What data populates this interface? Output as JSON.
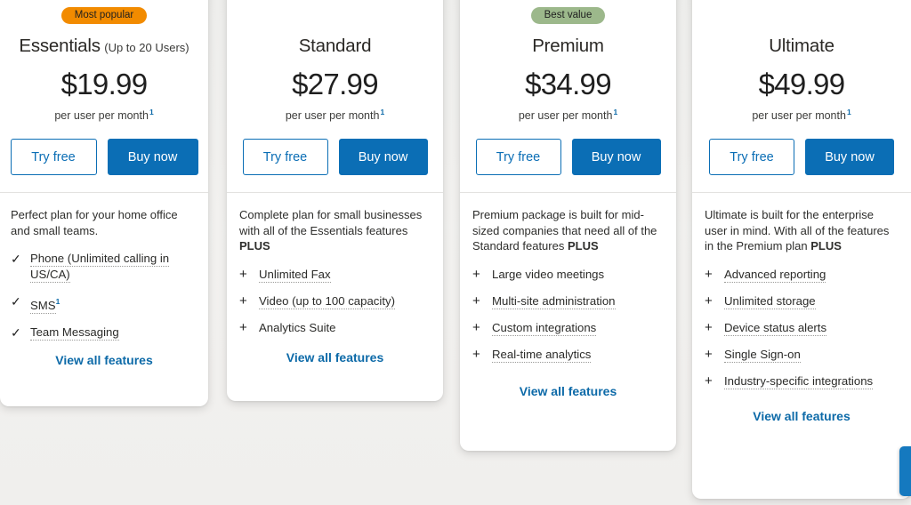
{
  "page": {
    "background_color": "#f1f0ee",
    "accent_blue": "#0b6eb5",
    "link_blue": "#0d6aa8",
    "badge_orange": "#f28b00",
    "badge_green": "#9cb88b"
  },
  "common": {
    "try_free_label": "Try free",
    "buy_now_label": "Buy now",
    "view_all_label": "View all features",
    "per_unit": "per user per month",
    "footnote_marker": "1",
    "check_icon": "✓",
    "plus_icon": "+"
  },
  "plans": [
    {
      "id": "essentials",
      "badge": "Most popular",
      "badge_style": "popular",
      "name": "Essentials",
      "qualifier": "(Up to 20 Users)",
      "price": "$19.99",
      "description_plain": "Perfect plan for your home office and small teams.",
      "description_bold": "",
      "feature_icon": "check",
      "features": [
        {
          "text": "Phone (Unlimited calling in US/CA)",
          "underlined": true,
          "footnote": false
        },
        {
          "text": "SMS",
          "underlined": true,
          "footnote": true
        },
        {
          "text": "Team Messaging",
          "underlined": true,
          "footnote": false
        }
      ]
    },
    {
      "id": "standard",
      "badge": "",
      "badge_style": "none",
      "name": "Standard",
      "qualifier": "",
      "price": "$27.99",
      "description_plain": "Complete plan for small businesses with all of the Essentials features ",
      "description_bold": "PLUS",
      "feature_icon": "plus",
      "features": [
        {
          "text": "Unlimited Fax",
          "underlined": true,
          "footnote": false
        },
        {
          "text": "Video (up to 100 capacity)",
          "underlined": true,
          "footnote": false
        },
        {
          "text": "Analytics Suite",
          "underlined": false,
          "footnote": false
        }
      ]
    },
    {
      "id": "premium",
      "badge": "Best value",
      "badge_style": "value",
      "name": "Premium",
      "qualifier": "",
      "price": "$34.99",
      "description_plain": "Premium package is built for mid-sized companies that need all of the Standard features ",
      "description_bold": "PLUS",
      "feature_icon": "plus",
      "features": [
        {
          "text": "Large video meetings",
          "underlined": false,
          "footnote": false
        },
        {
          "text": "Multi-site administration",
          "underlined": true,
          "footnote": false
        },
        {
          "text": "Custom integrations",
          "underlined": true,
          "footnote": false
        },
        {
          "text": "Real-time analytics",
          "underlined": true,
          "footnote": false
        }
      ]
    },
    {
      "id": "ultimate",
      "badge": "",
      "badge_style": "none",
      "name": "Ultimate",
      "qualifier": "",
      "price": "$49.99",
      "description_plain": "Ultimate is built for the enterprise user in mind. With all of the features in the Premium plan ",
      "description_bold": "PLUS",
      "feature_icon": "plus",
      "features": [
        {
          "text": "Advanced reporting",
          "underlined": true,
          "footnote": false
        },
        {
          "text": "Unlimited storage",
          "underlined": true,
          "footnote": false
        },
        {
          "text": "Device status alerts",
          "underlined": true,
          "footnote": false
        },
        {
          "text": "Single Sign-on",
          "underlined": true,
          "footnote": false
        },
        {
          "text": "Industry-specific integrations",
          "underlined": true,
          "footnote": false
        }
      ]
    }
  ],
  "side_tab": {
    "color": "#1579bf"
  }
}
